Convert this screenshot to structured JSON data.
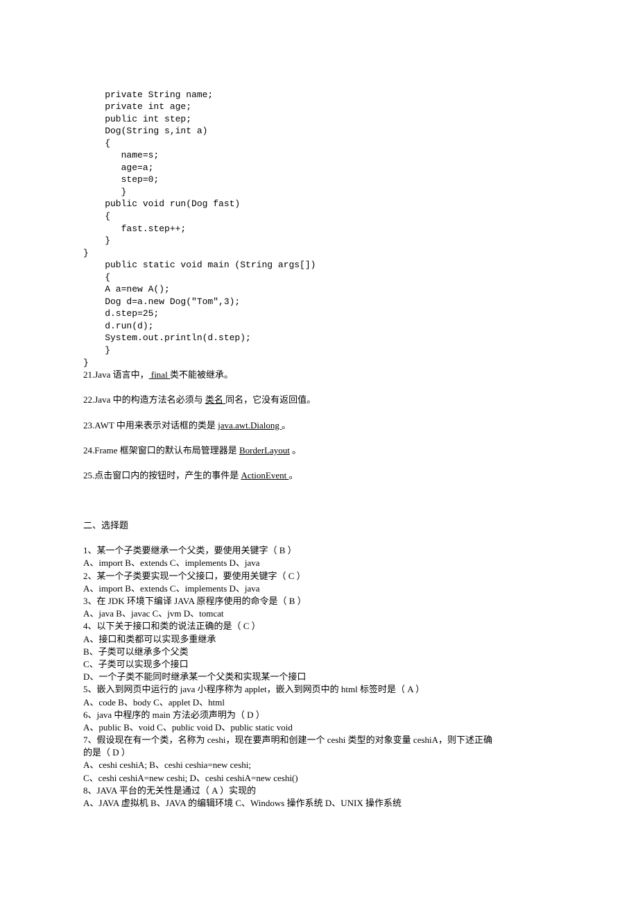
{
  "code": {
    "l1": "    private String name;",
    "l2": "    private int age;",
    "l3": "    public int step;",
    "l4": "    Dog(String s,int a)",
    "l5": "    {",
    "l6": "       name=s;",
    "l7": "       age=a;",
    "l8": "       step=0;",
    "l9": "       }",
    "l10": "    public void run(Dog fast)",
    "l11": "    {",
    "l12": "       fast.step++;",
    "l13": "    }",
    "l14": "}",
    "l15": "    public static void main (String args[])",
    "l16": "    {",
    "l17": "    A a=new A();",
    "l18": "    Dog d=a.new Dog(\"Tom\",3);",
    "l19": "    d.step=25;",
    "l20": "    d.run(d);",
    "l21": "    System.out.println(d.step);",
    "l22": "    }",
    "l23": "}"
  },
  "q21": {
    "pre": "21.Java 语言中，",
    "blank": "   final    ",
    "post": " 类不能被继承。"
  },
  "q22": {
    "pre": "22.Java 中的构造方法名必须与 ",
    "blank": "  类名   ",
    "post": " 同名，它没有返回值。"
  },
  "q23": {
    "pre": "23.AWT 中用来表示对话框的类是 ",
    "blank": "  java.awt.Dialong  ",
    "post": "。"
  },
  "q24": {
    "pre": "24.Frame 框架窗口的默认布局管理器是 ",
    "blank": "BorderLayout",
    "post": " 。"
  },
  "q25": {
    "pre": "25.点击窗口内的按钮时，产生的事件是 ",
    "blank": "   ActionEvent      ",
    "post": " 。"
  },
  "sectionTitle": "二、选择题",
  "mc": {
    "q1": "1、某一个子类要继承一个父类，要使用关键字（    B     ）",
    "q1opts": "A、import    B、extends    C、implements      D、java",
    "q2": "2、某一个子类要实现一个父接口，要使用关键字（    C     ）",
    "q2opts": "A、import         B、extends       C、implements      D、java",
    "q3": "3、在 JDK 环境下编译 JAVA 原程序使用的命令是（ B      ）",
    "q3opts": "A、java            B、javac          C、jvm            D、tomcat",
    "q4": "4、以下关于接口和类的说法正确的是（    C     ）",
    "q4a": "A、接口和类都可以实现多重继承",
    "q4b": "B、子类可以继承多个父类",
    "q4c": "C、子类可以实现多个接口",
    "q4d": "D、一个子类不能同时继承某一个父类和实现某一个接口",
    "q5": "5、嵌入到网页中运行的 java 小程序称为 applet，嵌入到网页中的 html 标签时是（    A     ）",
    "q5opts": "A、code           B、body           C、applet         D、html",
    "q6": "6、java 中程序的 main 方法必须声明为（    D     ）",
    "q6opts": "A、public         B、void       C、public void       D、public static void",
    "q7": "7、假设现在有一个类，名称为 ceshi，现在要声明和创建一个 ceshi 类型的对象变量 ceshiA，则下述正确",
    "q7b": "的是（    D     ）",
    "q7A": "A、ceshi   ceshiA;                   B、ceshi ceshia=new ceshi;",
    "q7C": "C、ceshi ceshiA=new ceshi;       D、ceshi ceshiA=new ceshi()",
    "q8": "8、JAVA 平台的无关性是通过（    A    ）实现的",
    "q8opts": "A、JAVA 虚拟机       B、JAVA 的编辑环境      C、Windows 操作系统      D、UNIX 操作系统"
  }
}
